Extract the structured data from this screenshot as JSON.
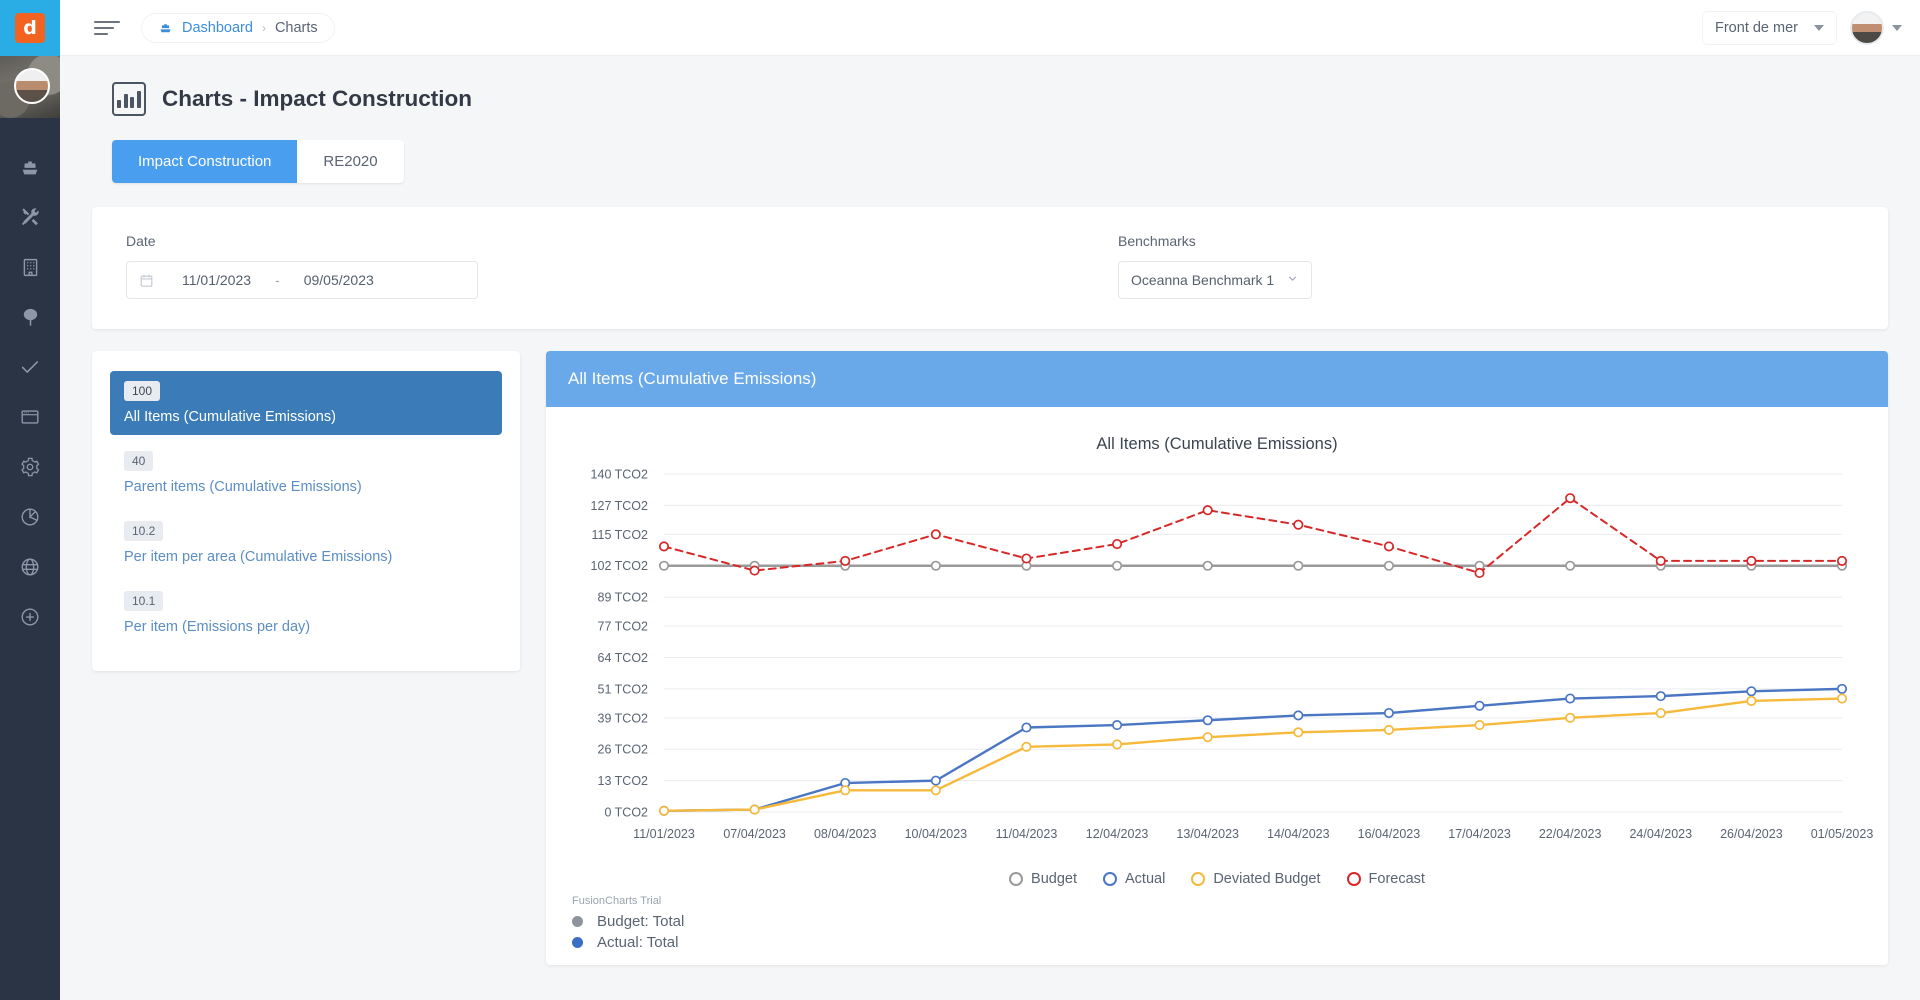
{
  "rail": {
    "logo_letter": "d",
    "items": [
      {
        "name": "ship-icon",
        "label": "Projects"
      },
      {
        "name": "tools-icon",
        "label": "Tools"
      },
      {
        "name": "building-icon",
        "label": "Buildings"
      },
      {
        "name": "tree-icon",
        "label": "Environment"
      },
      {
        "name": "check-icon",
        "label": "Tasks"
      },
      {
        "name": "window-icon",
        "label": "Reports"
      },
      {
        "name": "gear-icon",
        "label": "Settings"
      },
      {
        "name": "pie-chart-icon",
        "label": "Charts"
      },
      {
        "name": "globe-icon",
        "label": "Global"
      },
      {
        "name": "plus-circle-icon",
        "label": "Add"
      }
    ]
  },
  "topbar": {
    "menu_label": "Toggle menu",
    "breadcrumb": {
      "root": "Dashboard",
      "separator": "›",
      "current": "Charts"
    },
    "org_selector": {
      "value": "Front de mer"
    },
    "user_menu_label": ""
  },
  "page": {
    "title": "Charts - Impact Construction",
    "tabs": [
      {
        "label": "Impact Construction",
        "active": true
      },
      {
        "label": "RE2020",
        "active": false
      }
    ]
  },
  "filters": {
    "date": {
      "label": "Date",
      "start": "11/01/2023",
      "separator": "-",
      "end": "09/05/2023"
    },
    "benchmarks": {
      "label": "Benchmarks",
      "value": "Oceanna Benchmark 1"
    }
  },
  "items_panel": {
    "items": [
      {
        "badge": "100",
        "label": "All Items (Cumulative Emissions)",
        "active": true
      },
      {
        "badge": "40",
        "label": "Parent items (Cumulative Emissions)",
        "active": false
      },
      {
        "badge": "10.2",
        "label": "Per item per area (Cumulative Emissions)",
        "active": false
      },
      {
        "badge": "10.1",
        "label": "Per item (Emissions per day)",
        "active": false
      }
    ]
  },
  "chart_panel": {
    "header": "All Items (Cumulative Emissions)",
    "watermark": "FusionCharts Trial",
    "tooltip_lines": [
      {
        "label": "Budget: Total",
        "color": "#8d949d"
      },
      {
        "label": "Actual: Total",
        "color": "#3a6fc4"
      }
    ]
  },
  "chart_data": {
    "type": "line",
    "title": "All Items (Cumulative Emissions)",
    "xlabel": "",
    "ylabel": "",
    "ylim": [
      0,
      140
    ],
    "yticks": [
      0,
      13,
      26,
      39,
      51,
      64,
      77,
      89,
      102,
      115,
      127,
      140
    ],
    "ytick_labels": [
      "0 TCO2",
      "13 TCO2",
      "26 TCO2",
      "39 TCO2",
      "51 TCO2",
      "64 TCO2",
      "77 TCO2",
      "89 TCO2",
      "102 TCO2",
      "115 TCO2",
      "127 TCO2",
      "140 TCO2"
    ],
    "grid": true,
    "legend_position": "bottom",
    "categories": [
      "11/01/2023",
      "07/04/2023",
      "08/04/2023",
      "10/04/2023",
      "11/04/2023",
      "12/04/2023",
      "13/04/2023",
      "14/04/2023",
      "16/04/2023",
      "17/04/2023",
      "22/04/2023",
      "24/04/2023",
      "26/04/2023",
      "01/05/2023"
    ],
    "series": [
      {
        "name": "Budget",
        "color": "#9a9a9a",
        "style": "solid",
        "values": [
          102,
          102,
          102,
          102,
          102,
          102,
          102,
          102,
          102,
          102,
          102,
          102,
          102,
          102
        ]
      },
      {
        "name": "Actual",
        "color": "#4a76c4",
        "style": "solid",
        "values": [
          0.5,
          1,
          12,
          13,
          35,
          36,
          38,
          40,
          41,
          44,
          47,
          48,
          50,
          51
        ]
      },
      {
        "name": "Deviated Budget",
        "color": "#f6b93b",
        "style": "solid",
        "values": [
          0.5,
          1,
          9,
          9,
          27,
          28,
          31,
          33,
          34,
          36,
          39,
          41,
          46,
          47
        ]
      },
      {
        "name": "Forecast",
        "color": "#d62828",
        "style": "dotted",
        "values": [
          110,
          100,
          104,
          115,
          105,
          111,
          125,
          119,
          110,
          99,
          130,
          104,
          104,
          104
        ]
      }
    ],
    "legend": [
      {
        "label": "Budget",
        "color": "#9a9a9a"
      },
      {
        "label": "Actual",
        "color": "#4a76c4"
      },
      {
        "label": "Deviated Budget",
        "color": "#f6b93b"
      },
      {
        "label": "Forecast",
        "color": "#d62828"
      }
    ]
  }
}
